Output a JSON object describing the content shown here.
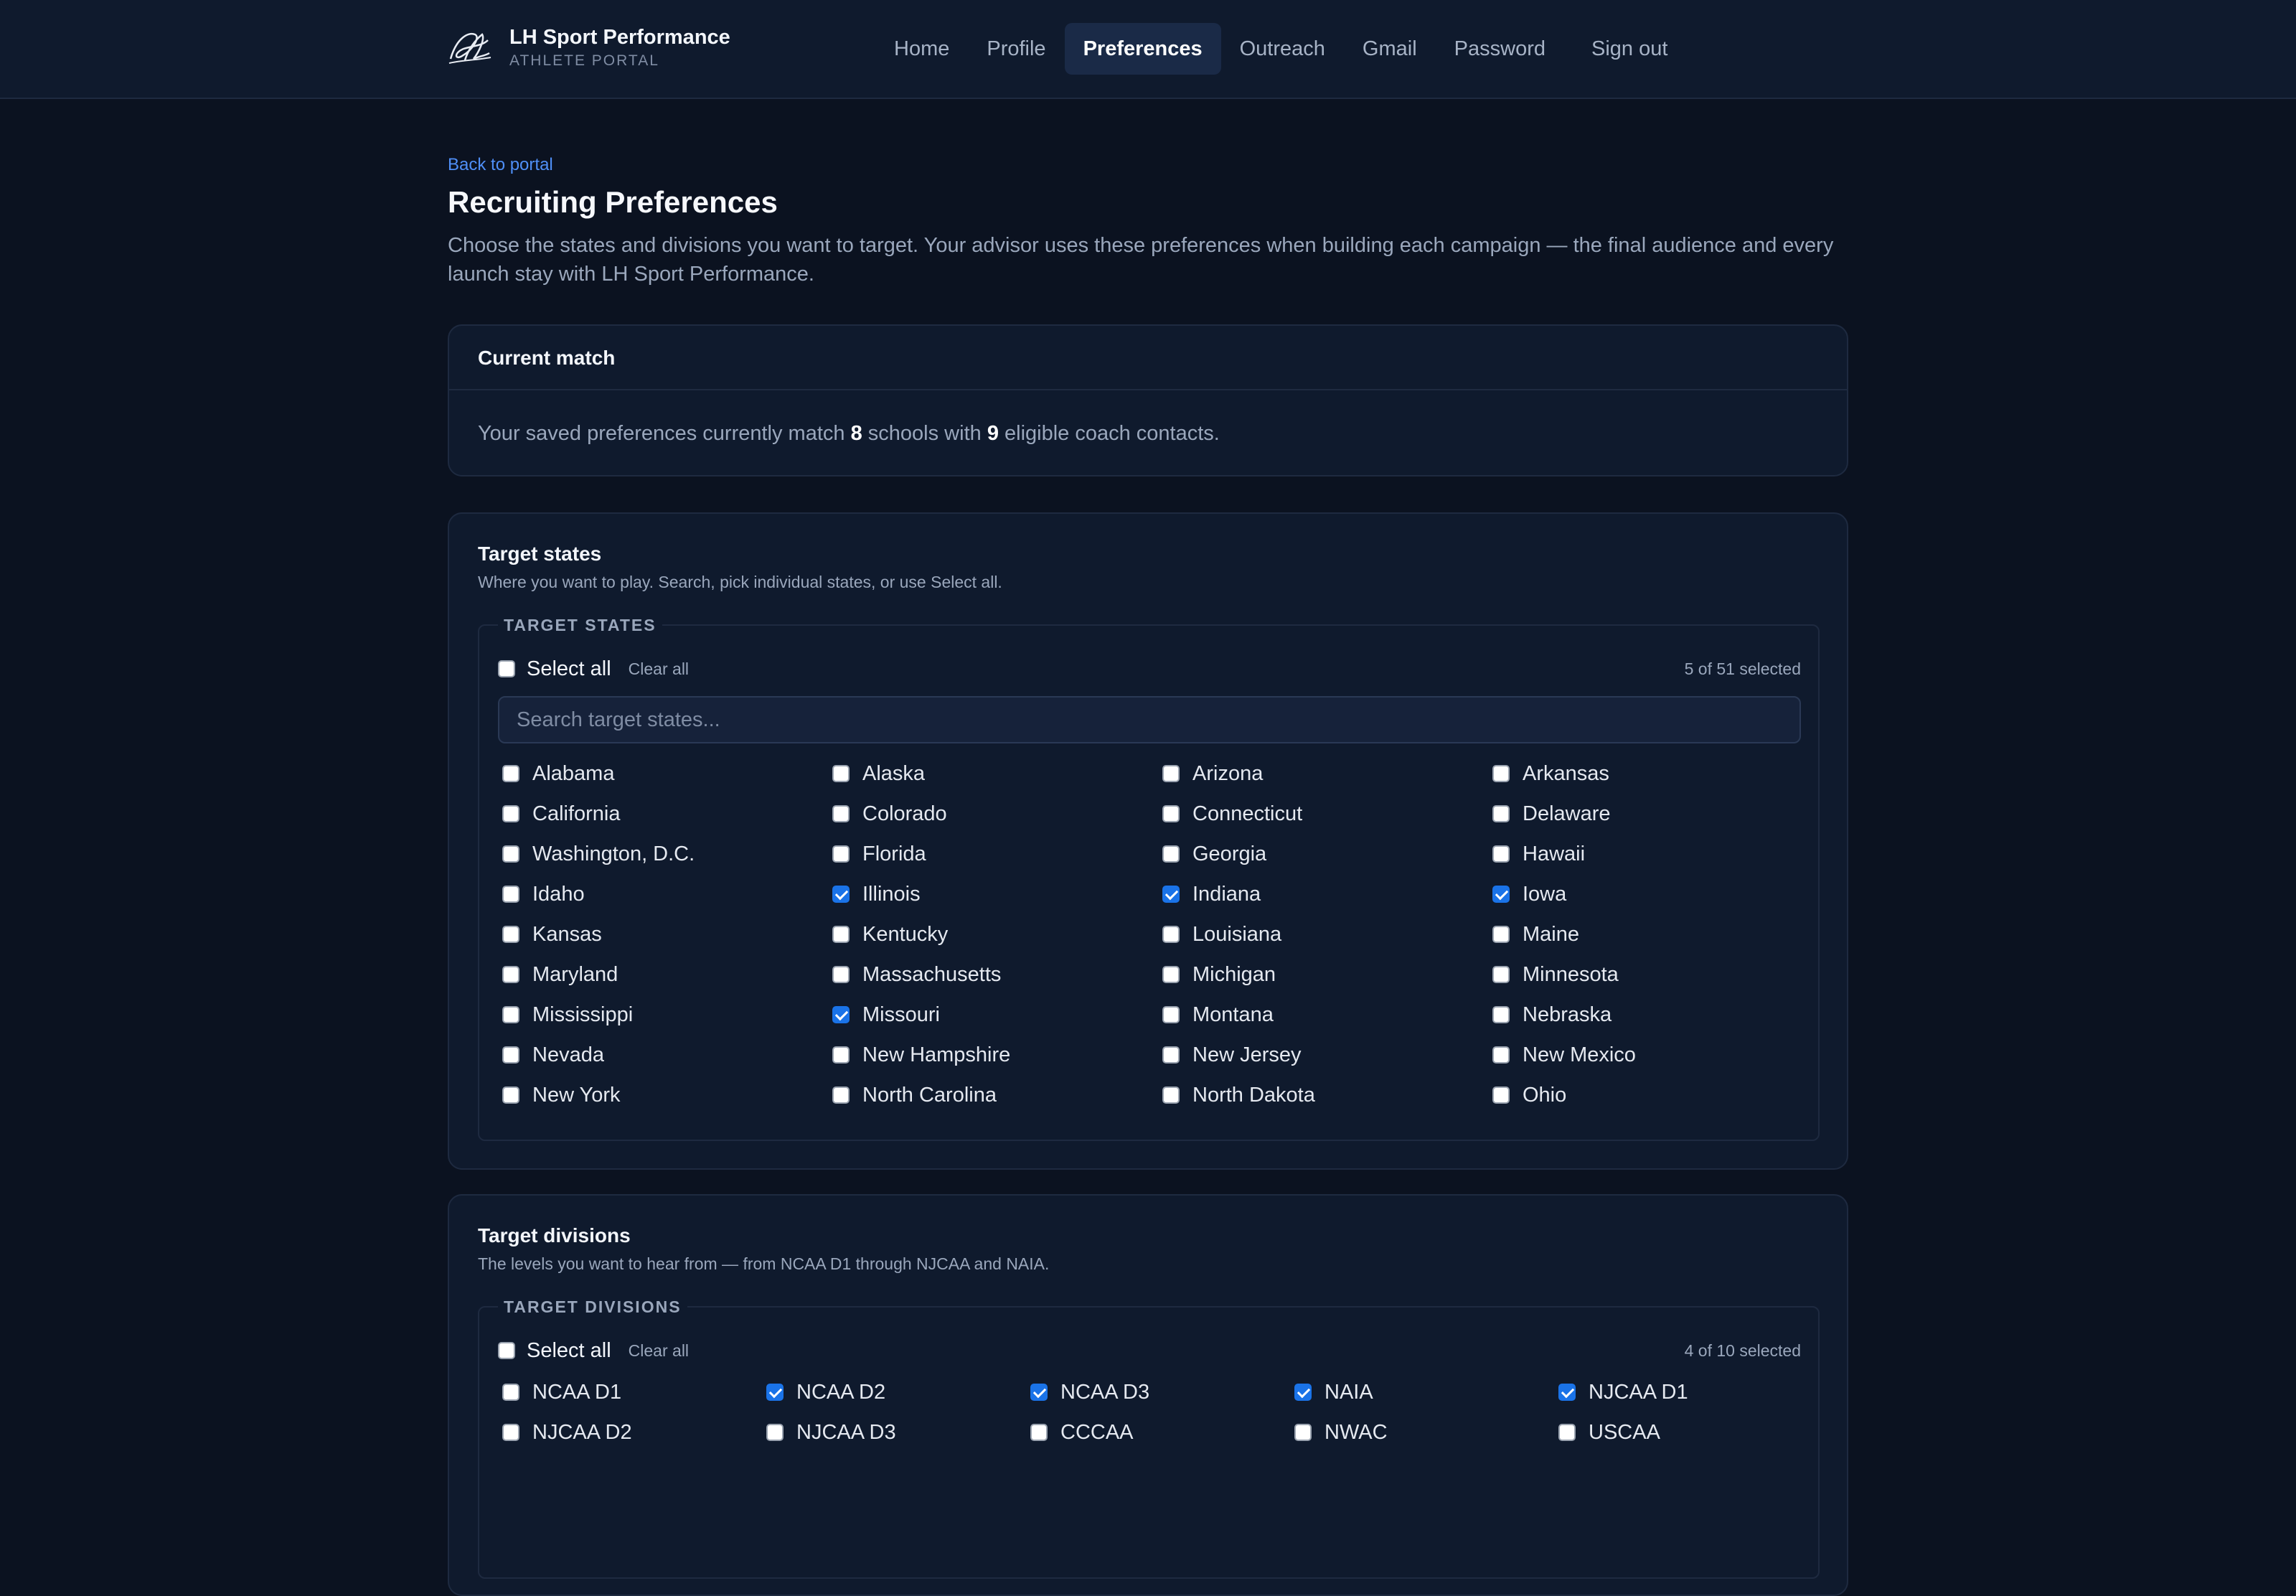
{
  "brand": {
    "name": "LH Sport Performance",
    "subtitle": "ATHLETE PORTAL"
  },
  "nav": {
    "items": [
      {
        "label": "Home",
        "active": false
      },
      {
        "label": "Profile",
        "active": false
      },
      {
        "label": "Preferences",
        "active": true
      },
      {
        "label": "Outreach",
        "active": false
      },
      {
        "label": "Gmail",
        "active": false
      },
      {
        "label": "Password",
        "active": false
      },
      {
        "label": "Sign out",
        "active": false
      }
    ]
  },
  "page": {
    "back_link": "Back to portal",
    "title": "Recruiting Preferences",
    "description": "Choose the states and divisions you want to target. Your advisor uses these preferences when building each campaign — the final audience and every launch stay with LH Sport Performance."
  },
  "current_match": {
    "heading": "Current match",
    "text_prefix": "Your saved preferences currently match ",
    "schools": "8",
    "text_middle": " schools with ",
    "contacts": "9",
    "text_suffix": " eligible coach contacts."
  },
  "states": {
    "title": "Target states",
    "subtitle": "Where you want to play. Search, pick individual states, or use Select all.",
    "legend": "TARGET STATES",
    "select_all": "Select all",
    "clear_all": "Clear all",
    "count": "5 of 51 selected",
    "search_placeholder": "Search target states...",
    "options": [
      {
        "label": "Alabama",
        "checked": false
      },
      {
        "label": "Alaska",
        "checked": false
      },
      {
        "label": "Arizona",
        "checked": false
      },
      {
        "label": "Arkansas",
        "checked": false
      },
      {
        "label": "California",
        "checked": false
      },
      {
        "label": "Colorado",
        "checked": false
      },
      {
        "label": "Connecticut",
        "checked": false
      },
      {
        "label": "Delaware",
        "checked": false
      },
      {
        "label": "Washington, D.C.",
        "checked": false
      },
      {
        "label": "Florida",
        "checked": false
      },
      {
        "label": "Georgia",
        "checked": false
      },
      {
        "label": "Hawaii",
        "checked": false
      },
      {
        "label": "Idaho",
        "checked": false
      },
      {
        "label": "Illinois",
        "checked": true
      },
      {
        "label": "Indiana",
        "checked": true
      },
      {
        "label": "Iowa",
        "checked": true
      },
      {
        "label": "Kansas",
        "checked": false
      },
      {
        "label": "Kentucky",
        "checked": false
      },
      {
        "label": "Louisiana",
        "checked": false
      },
      {
        "label": "Maine",
        "checked": false
      },
      {
        "label": "Maryland",
        "checked": false
      },
      {
        "label": "Massachusetts",
        "checked": false
      },
      {
        "label": "Michigan",
        "checked": false
      },
      {
        "label": "Minnesota",
        "checked": false
      },
      {
        "label": "Mississippi",
        "checked": false
      },
      {
        "label": "Missouri",
        "checked": true
      },
      {
        "label": "Montana",
        "checked": false
      },
      {
        "label": "Nebraska",
        "checked": false
      },
      {
        "label": "Nevada",
        "checked": false
      },
      {
        "label": "New Hampshire",
        "checked": false
      },
      {
        "label": "New Jersey",
        "checked": false
      },
      {
        "label": "New Mexico",
        "checked": false
      },
      {
        "label": "New York",
        "checked": false
      },
      {
        "label": "North Carolina",
        "checked": false
      },
      {
        "label": "North Dakota",
        "checked": false
      },
      {
        "label": "Ohio",
        "checked": false
      }
    ]
  },
  "divisions": {
    "title": "Target divisions",
    "subtitle": "The levels you want to hear from — from NCAA D1 through NJCAA and NAIA.",
    "legend": "TARGET DIVISIONS",
    "select_all": "Select all",
    "clear_all": "Clear all",
    "count": "4 of 10 selected",
    "options": [
      {
        "label": "NCAA D1",
        "checked": false
      },
      {
        "label": "NCAA D2",
        "checked": true
      },
      {
        "label": "NCAA D3",
        "checked": true
      },
      {
        "label": "NAIA",
        "checked": true
      },
      {
        "label": "NJCAA D1",
        "checked": true
      },
      {
        "label": "NJCAA D2",
        "checked": false
      },
      {
        "label": "NJCAA D3",
        "checked": false
      },
      {
        "label": "CCCAA",
        "checked": false
      },
      {
        "label": "NWAC",
        "checked": false
      },
      {
        "label": "USCAA",
        "checked": false
      }
    ]
  }
}
